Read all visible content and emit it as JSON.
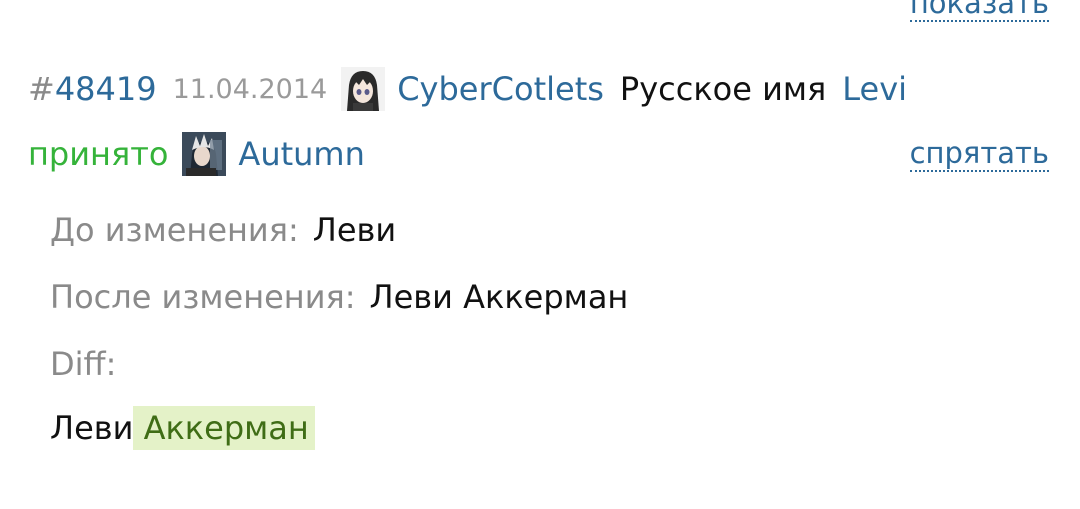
{
  "top": {
    "show_link": "показать"
  },
  "entry": {
    "hash": "#",
    "id": "48419",
    "date": "11.04.2014",
    "author": "CyberCotlets",
    "field": "Русское имя",
    "value": "Levi",
    "status": "принято",
    "moderator": "Autumn",
    "hide_link": "спрятать"
  },
  "details": {
    "before_label": "До изменения:",
    "before_value": "Леви",
    "after_label": "После изменения:",
    "after_value": "Леви Аккерман",
    "diff_label": "Diff:",
    "diff_kept": "Леви",
    "diff_added": "Аккерман"
  },
  "colors": {
    "link": "#2d6a9a",
    "accepted": "#35b33a",
    "muted": "#8a8a8a",
    "diff_added_bg": "#e4f2c8",
    "diff_added_text": "#3f6d16"
  },
  "icons": {
    "author_avatar": "anime-girl-avatar",
    "moderator_avatar": "anime-character-avatar"
  }
}
